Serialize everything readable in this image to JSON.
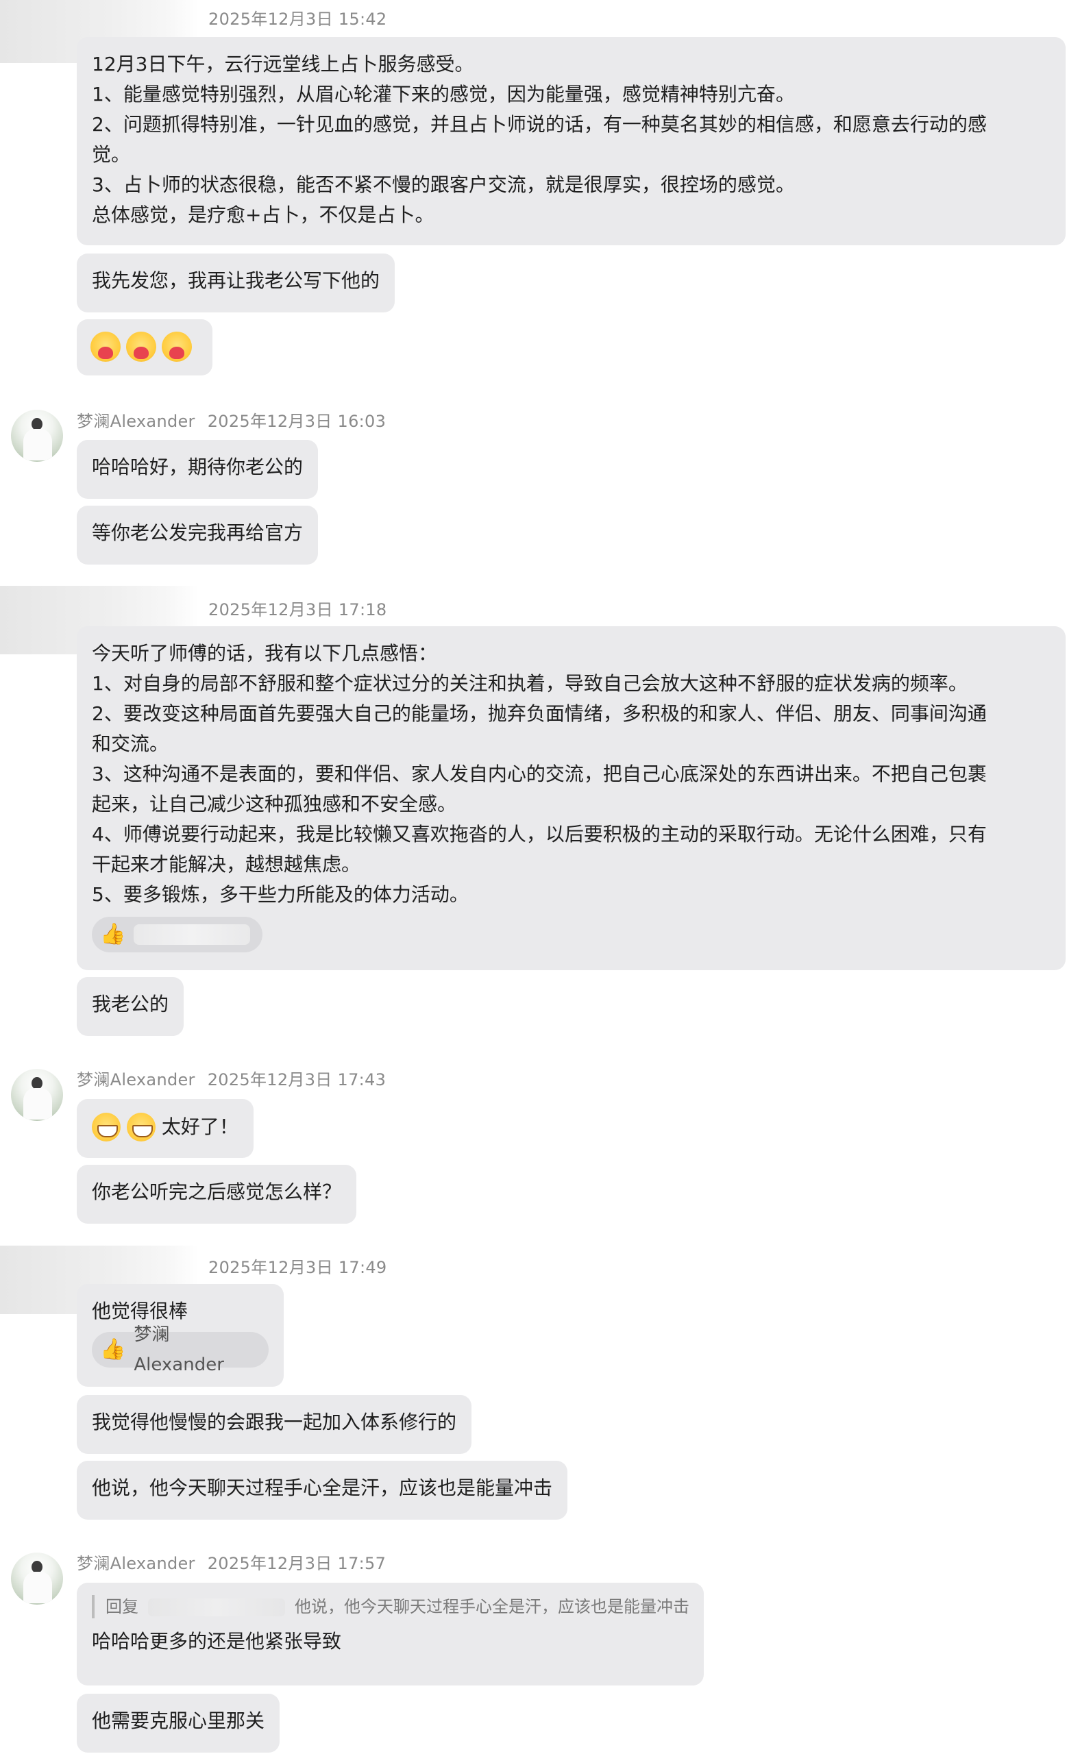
{
  "conversation": {
    "g1": {
      "timestamp": "2025年12月3日 15:42",
      "messages": {
        "m1": {
          "lines": [
            "12月3日下午，云行远堂线上占卜服务感受。",
            "1、能量感觉特别强烈，从眉心轮灌下来的感觉，因为能量强，感觉精神特别亢奋。",
            "2、问题抓得特别准，一针见血的感觉，并且占卜师说的话，有一种莫名其妙的相信感，和愿意去行动的感",
            "觉。",
            "3、占卜师的状态很稳，能否不紧不慢的跟客户交流，就是很厚实，很控场的感觉。",
            "总体感觉，是疗愈+占卜，不仅是占卜。"
          ]
        },
        "m2": "我先发您，我再让我老公写下他的",
        "m3_icon": "hug-heart-emoji x3"
      }
    },
    "g2": {
      "username": "梦澜Alexander",
      "timestamp": "2025年12月3日 16:03",
      "messages": {
        "m1": "哈哈哈好，期待你老公的",
        "m2": "等你老公发完我再给官方"
      }
    },
    "g3": {
      "timestamp": "2025年12月3日 17:18",
      "messages": {
        "m1": {
          "lines": [
            "今天听了师傅的话，我有以下几点感悟：",
            "1、对自身的局部不舒服和整个症状过分的关注和执着，导致自己会放大这种不舒服的症状发病的频率。",
            "2、要改变这种局面首先要强大自己的能量场，抛弃负面情绪，多积极的和家人、伴侣、朋友、同事间沟通",
            "和交流。",
            "3、这种沟通不是表面的，要和伴侣、家人发自内心的交流，把自己心底深处的东西讲出来。不把自己包裹",
            "起来，让自己减少这种孤独感和不安全感。",
            "4、师傅说要行动起来，我是比较懒又喜欢拖沓的人，以后要积极的主动的采取行动。无论什么困难，只有",
            "干起来才能解决，越想越焦虑。",
            "5、要多锻炼，多干些力所能及的体力活动。"
          ],
          "reaction_icon": "thumbs-up"
        },
        "m2": "我老公的"
      }
    },
    "g4": {
      "username": "梦澜Alexander",
      "timestamp": "2025年12月3日 17:43",
      "messages": {
        "m1_text": "太好了！",
        "m2": "你老公听完之后感觉怎么样？"
      }
    },
    "g5": {
      "timestamp": "2025年12月3日 17:49",
      "messages": {
        "m1": {
          "text": "他觉得很棒",
          "reaction_user": "梦澜Alexander"
        },
        "m2": "我觉得他慢慢的会跟我一起加入体系修行的",
        "m3": "他说，他今天聊天过程手心全是汗，应该也是能量冲击"
      }
    },
    "g6": {
      "username": "梦澜Alexander",
      "timestamp": "2025年12月3日 17:57",
      "messages": {
        "m1": {
          "quote_prefix": "回复",
          "quote_text": "他说，他今天聊天过程手心全是汗，应该也是能量冲击",
          "text": "哈哈哈更多的还是他紧张导致"
        },
        "m2": "他需要克服心里那关"
      }
    }
  },
  "colors": {
    "bubble": "#eaeaec",
    "meta_text": "#8a8a8a",
    "text": "#1f1f1f"
  }
}
